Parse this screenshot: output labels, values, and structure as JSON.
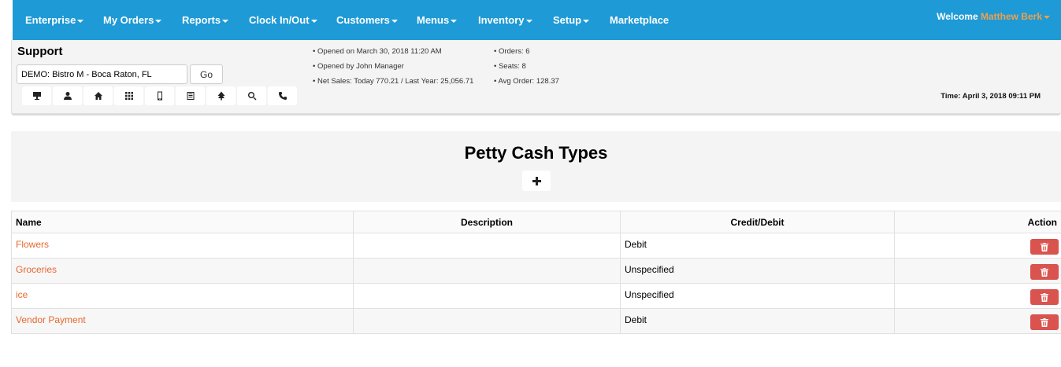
{
  "nav": {
    "items": [
      {
        "label": "Enterprise",
        "dropdown": true
      },
      {
        "label": "My Orders",
        "dropdown": true
      },
      {
        "label": "Reports",
        "dropdown": true
      },
      {
        "label": "Clock In/Out",
        "dropdown": true
      },
      {
        "label": "Customers",
        "dropdown": true
      },
      {
        "label": "Menus",
        "dropdown": true
      },
      {
        "label": "Inventory",
        "dropdown": true
      },
      {
        "label": "Setup",
        "dropdown": true
      },
      {
        "label": "Marketplace",
        "dropdown": false
      }
    ],
    "welcome_text": "Welcome",
    "user_name": "Matthew Berk"
  },
  "header": {
    "title": "Support",
    "location_value": "DEMO: Bistro M - Boca Raton, FL",
    "go_label": "Go",
    "icons": [
      "presentation-icon",
      "user-icon",
      "home-icon",
      "grid-icon",
      "mobile-icon",
      "list-icon",
      "tree-icon",
      "search-icon",
      "phone-icon"
    ],
    "info_left": [
      "• Opened on March 30, 2018 11:20 AM",
      "• Opened by John Manager",
      "• Net Sales: Today 770.21 / Last Year: 25,056.71"
    ],
    "info_right": [
      "• Orders: 6",
      "• Seats: 8",
      "• Avg Order: 128.37"
    ],
    "time": "Time: April 3, 2018 09:11 PM"
  },
  "page": {
    "title": "Petty Cash Types",
    "add_icon": "plus-icon"
  },
  "table": {
    "columns": [
      "Name",
      "Description",
      "Credit/Debit",
      "Action"
    ],
    "rows": [
      {
        "name": "Flowers",
        "description": "",
        "credit_debit": "Debit"
      },
      {
        "name": "Groceries",
        "description": "",
        "credit_debit": "Unspecified"
      },
      {
        "name": "ice",
        "description": "",
        "credit_debit": "Unspecified"
      },
      {
        "name": "Vendor Payment",
        "description": "",
        "credit_debit": "Debit"
      }
    ],
    "delete_icon": "trash-icon"
  },
  "colors": {
    "nav_bg": "#1e9ad6",
    "link": "#e8692f",
    "user_name": "#f0a04b",
    "delete_button": "#d9534f"
  }
}
